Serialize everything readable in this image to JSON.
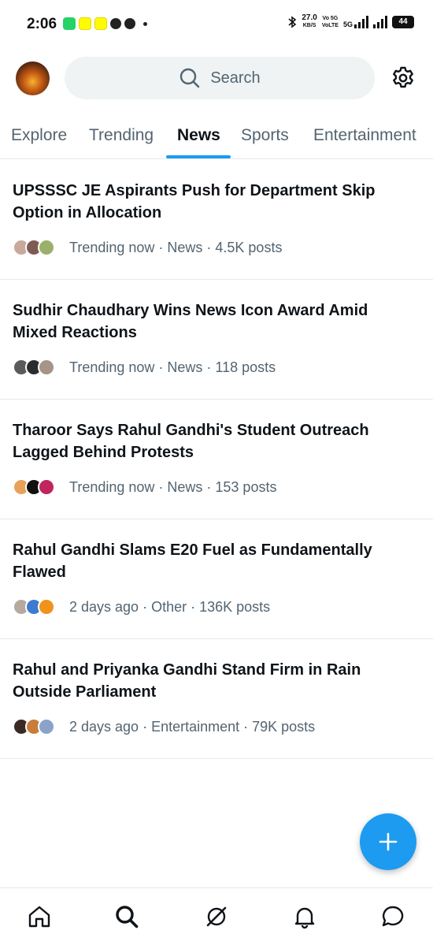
{
  "status_bar": {
    "time": "2:06",
    "net_speed": "27.0",
    "net_unit": "KB/S",
    "volte1": "Vo 5G",
    "volte2": "VoLTE",
    "network": "5G",
    "battery": "44"
  },
  "header": {
    "search_placeholder": "Search",
    "avatar_icon": "profile-avatar",
    "settings_icon": "gear-icon"
  },
  "tabs": [
    {
      "label": "Explore"
    },
    {
      "label": "Trending"
    },
    {
      "label": "News",
      "active": true
    },
    {
      "label": "Sports"
    },
    {
      "label": "Entertainment"
    }
  ],
  "feed": [
    {
      "title": "UPSSSC JE Aspirants Push for Department Skip Option in Allocation",
      "meta": "Trending now · News · 4.5K posts"
    },
    {
      "title": "Sudhir Chaudhary Wins News Icon Award Amid Mixed Reactions",
      "meta": "Trending now · News · 118 posts"
    },
    {
      "title": "Tharoor Says Rahul Gandhi's Student Outreach Lagged Behind Protests",
      "meta": "Trending now · News · 153 posts"
    },
    {
      "title": "Rahul Gandhi Slams E20 Fuel as Fundamentally Flawed",
      "meta": "2 days ago · Other · 136K posts"
    },
    {
      "title": "Rahul and Priyanka Gandhi Stand Firm in Rain Outside Parliament",
      "meta": "2 days ago · Entertainment · 79K posts"
    }
  ],
  "colors": {
    "accent": "#1d9bf0",
    "text_primary": "#0f1419",
    "text_secondary": "#536471"
  },
  "bottom_nav": [
    "home-icon",
    "search-icon",
    "grok-icon",
    "notifications-icon",
    "messages-icon"
  ]
}
